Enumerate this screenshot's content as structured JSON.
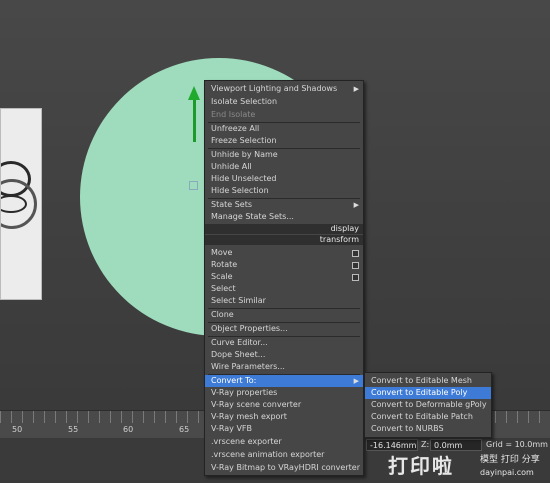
{
  "viewport": {
    "object_color": "#9fdbbd",
    "gizmo_color": "#1faa2e"
  },
  "quad_menu": {
    "items": [
      {
        "label": "Viewport Lighting and Shadows",
        "submenu": true
      },
      {
        "label": "Isolate Selection"
      },
      {
        "label": "End Isolate",
        "disabled": true
      },
      {
        "label": "Unfreeze All"
      },
      {
        "label": "Freeze Selection"
      },
      {
        "label": "Unhide by Name"
      },
      {
        "label": "Unhide All"
      },
      {
        "label": "Hide Unselected"
      },
      {
        "label": "Hide Selection"
      },
      {
        "label": "State Sets",
        "submenu": true
      },
      {
        "label": "Manage State Sets..."
      },
      {
        "label": "display",
        "quad_label": true
      },
      {
        "label": "transform",
        "quad_label": true
      },
      {
        "label": "Move"
      },
      {
        "label": "Rotate"
      },
      {
        "label": "Scale"
      },
      {
        "label": "Select"
      },
      {
        "label": "Select Similar"
      },
      {
        "label": "Clone"
      },
      {
        "label": "Object Properties..."
      },
      {
        "label": "Curve Editor..."
      },
      {
        "label": "Dope Sheet..."
      },
      {
        "label": "Wire Parameters..."
      },
      {
        "label": "Convert To:",
        "submenu": true,
        "highlight": true
      },
      {
        "label": "V-Ray properties"
      },
      {
        "label": "V-Ray scene converter"
      },
      {
        "label": "V-Ray mesh export"
      },
      {
        "label": "V-Ray VFB"
      },
      {
        "label": ".vrscene exporter"
      },
      {
        "label": ".vrscene animation exporter"
      },
      {
        "label": "V-Ray Bitmap to VRayHDRI converter"
      }
    ]
  },
  "convert_submenu": {
    "items": [
      {
        "label": "Convert to Editable Mesh"
      },
      {
        "label": "Convert to Editable Poly",
        "highlight": true
      },
      {
        "label": "Convert to Deformable gPoly"
      },
      {
        "label": "Convert to Editable Patch"
      },
      {
        "label": "Convert to NURBS"
      }
    ]
  },
  "timeline": {
    "ticks": [
      "50",
      "55",
      "60",
      "65"
    ]
  },
  "status": {
    "x_value": "-16.146mm",
    "z_label": "Z:",
    "z_value": "0.0mm",
    "grid": "Grid = 10.0mm"
  },
  "watermark": {
    "main": "打印啦",
    "sub": "模型 打印 分享",
    "url": "dayinpai.com"
  },
  "colors": {
    "highlight": "#3d7bd6",
    "menu_bg": "#464646"
  }
}
